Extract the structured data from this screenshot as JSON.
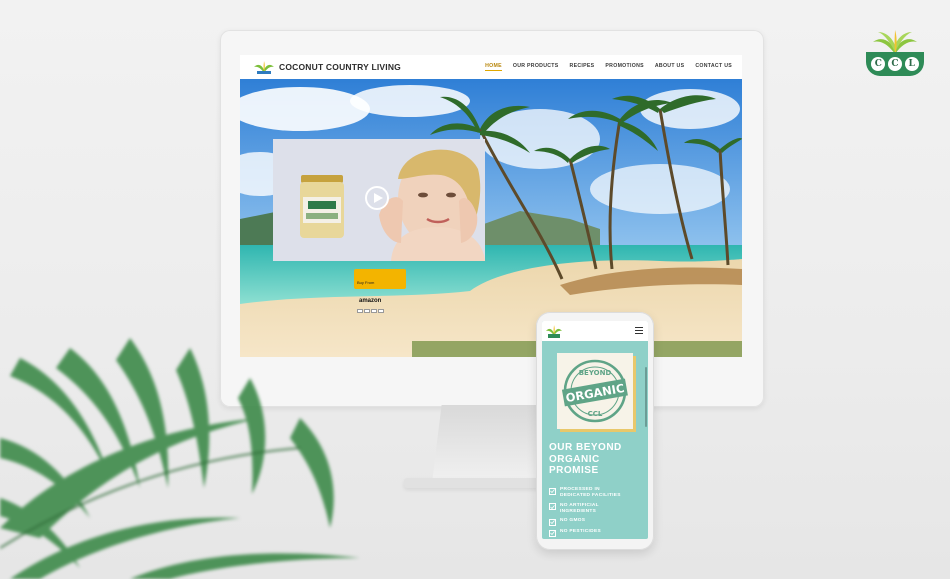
{
  "brand_badge": {
    "letters": [
      "C",
      "C",
      "L"
    ]
  },
  "website": {
    "title": "COCONUT COUNTRY LIVING",
    "nav": [
      "HOME",
      "OUR PRODUCTS",
      "RECIPES",
      "PROMOTIONS",
      "ABOUT US",
      "CONTACT US"
    ],
    "active_nav": "HOME",
    "amazon_button": {
      "prefix": "Buy From",
      "brand": "amazon"
    }
  },
  "mobile": {
    "badge_text": {
      "top": "BEYOND",
      "middle": "ORGANIC",
      "bottom": "CCL"
    },
    "heading_lines": [
      "OUR BEYOND",
      "ORGANIC",
      "PROMISE"
    ],
    "promises": [
      [
        "PROCESSED IN",
        "DEDICATED FACILITIES"
      ],
      [
        "NO ARTIFICIAL",
        "INGREDIENTS"
      ],
      [
        "NO GMOS"
      ],
      [
        "NO PESTICIDES"
      ]
    ]
  },
  "colors": {
    "accent_gold": "#e0a800",
    "brand_green": "#2e8b57",
    "mobile_teal": "#8fd0c8",
    "amazon_yellow": "#f3b400"
  },
  "icons": [
    "palm-logo-icon",
    "play-icon",
    "hamburger-menu-icon",
    "checkbox-icon"
  ]
}
